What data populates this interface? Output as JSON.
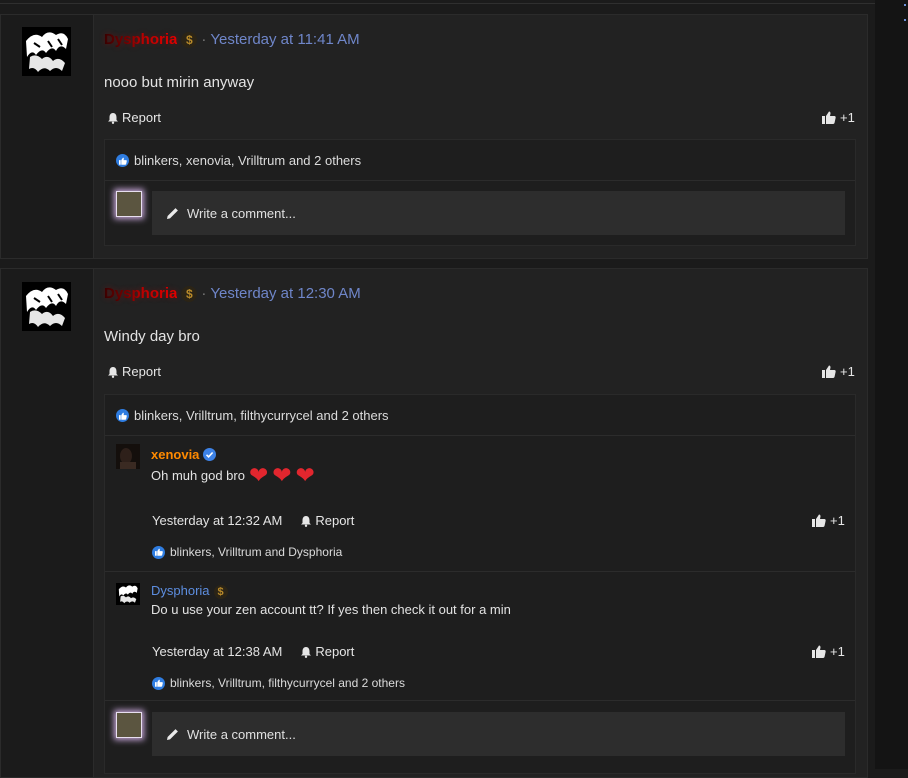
{
  "posts": [
    {
      "author": "Dysphoria",
      "time": "Yesterday at 11:41 AM",
      "message": "nooo but mirin anyway",
      "report_label": "Report",
      "like_label": "+1",
      "reactions": "blinkers, xenovia, Vrilltrum and 2 others",
      "comment_placeholder": "Write a comment..."
    },
    {
      "author": "Dysphoria",
      "time": "Yesterday at 12:30 AM",
      "message": "Windy day bro",
      "report_label": "Report",
      "like_label": "+1",
      "reactions": "blinkers, Vrilltrum, filthycurrycel and 2 others",
      "comment_placeholder": "Write a comment...",
      "comments": [
        {
          "author": "xenovia",
          "text": "Oh muh god bro",
          "time": "Yesterday at 12:32 AM",
          "report_label": "Report",
          "like_label": "+1",
          "reactions": "blinkers, Vrilltrum and Dysphoria"
        },
        {
          "author": "Dysphoria",
          "text": "Do u use your zen account tt? If yes then check it out for a min",
          "time": "Yesterday at 12:38 AM",
          "report_label": "Report",
          "like_label": "+1",
          "reactions": "blinkers, Vrilltrum, filthycurrycel and 2 others"
        }
      ]
    }
  ],
  "icons": {
    "bell": "bell-icon",
    "thumbs_up": "thumbs-up-icon",
    "pencil": "pencil-icon",
    "coin": "dollar-coin-icon",
    "verified": "verified-badge-icon",
    "heart": "heart-icon"
  },
  "colors": {
    "time_link": "#6f86c9",
    "author_red": "#e30000",
    "comment_author_orange": "#ff8a00",
    "comment_author_blue": "#5d8ee0",
    "like_blue": "#2f7de1"
  }
}
